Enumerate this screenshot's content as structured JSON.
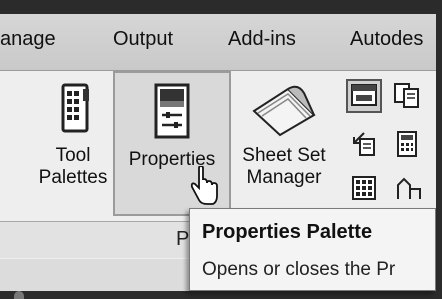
{
  "tabs": [
    {
      "label": "anage"
    },
    {
      "label": "Output"
    },
    {
      "label": "Add-ins"
    },
    {
      "label": "Autodes"
    }
  ],
  "tools": {
    "tool_palettes": {
      "line1": "Tool",
      "line2": "Palettes"
    },
    "properties": {
      "label": "Properties"
    },
    "sheet_set_manager": {
      "line1": "Sheet Set",
      "line2": "Manager"
    }
  },
  "panel": {
    "title_partial": "P"
  },
  "tooltip": {
    "title": "Properties Palette",
    "description": "Opens or closes the Pr"
  }
}
